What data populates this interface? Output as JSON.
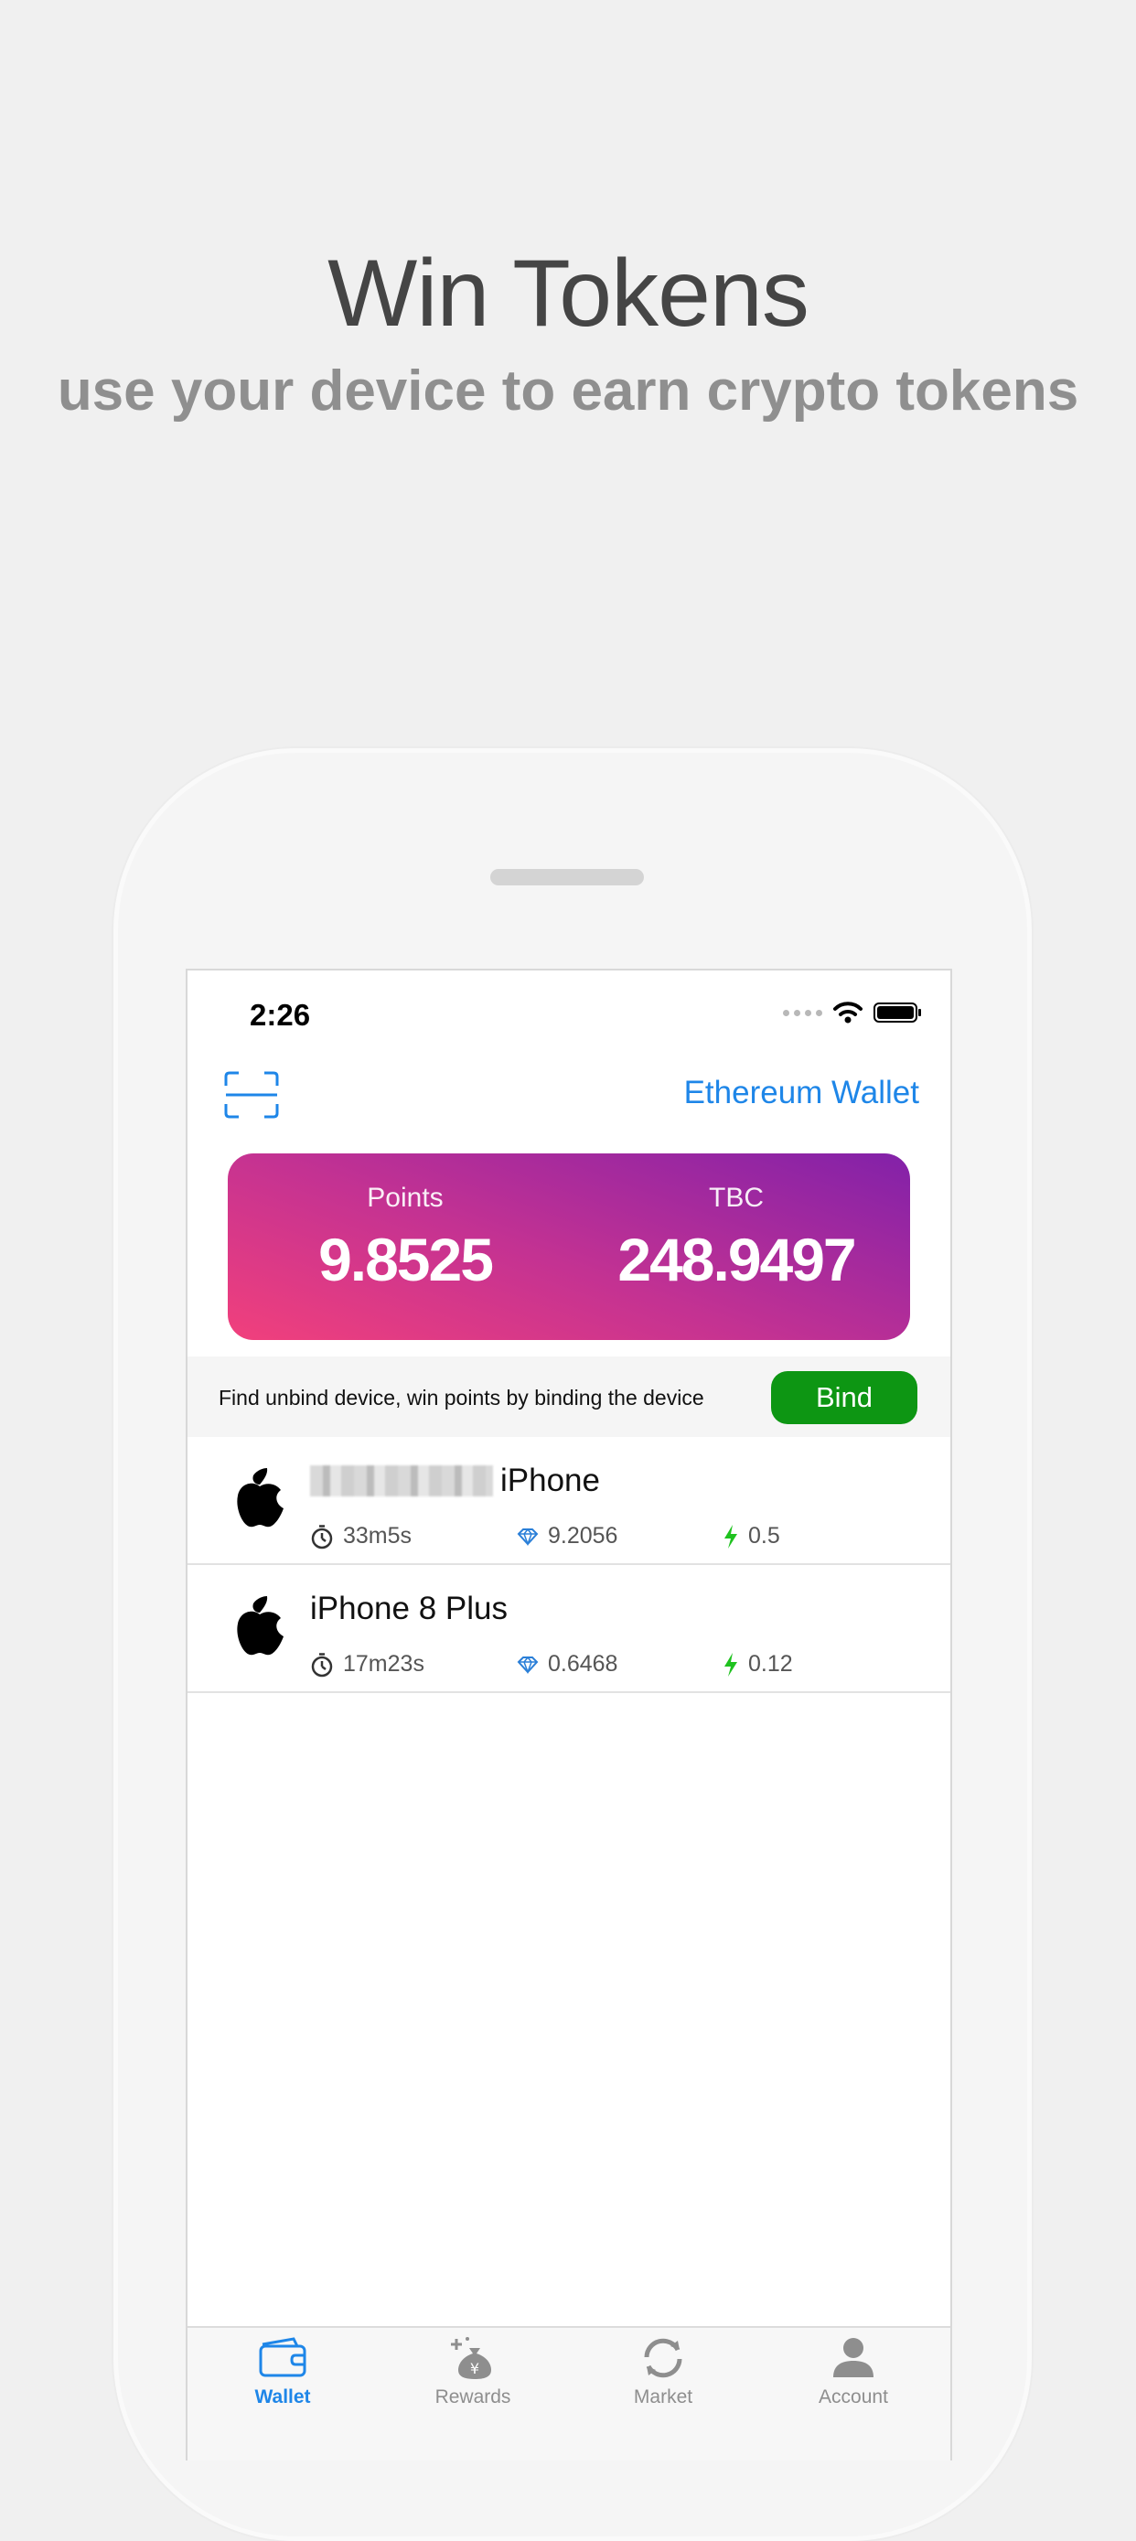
{
  "promo": {
    "title": "Win Tokens",
    "subtitle": "use your device to earn crypto tokens"
  },
  "status_bar": {
    "time": "2:26"
  },
  "header": {
    "wallet_link": "Ethereum Wallet"
  },
  "balance": {
    "points_label": "Points",
    "points_value": "9.8525",
    "tbc_label": "TBC",
    "tbc_value": "248.9497"
  },
  "bind": {
    "message": "Find unbind device, win points by binding the device",
    "button_label": "Bind"
  },
  "devices": [
    {
      "name": "iPhone",
      "time": "33m5s",
      "points": "9.2056",
      "power": "0.5"
    },
    {
      "name": "iPhone 8 Plus",
      "time": "17m23s",
      "points": "0.6468",
      "power": "0.12"
    }
  ],
  "tabs": [
    {
      "label": "Wallet",
      "icon": "wallet-icon",
      "active": true
    },
    {
      "label": "Rewards",
      "icon": "rewards-icon",
      "active": false
    },
    {
      "label": "Market",
      "icon": "market-icon",
      "active": false
    },
    {
      "label": "Account",
      "icon": "account-icon",
      "active": false
    }
  ],
  "colors": {
    "accent": "#1e86e8",
    "bind_green": "#0d9613",
    "card_gradient_start": "#f1407c",
    "card_gradient_end": "#8221a9",
    "power_green": "#1fc21f"
  }
}
